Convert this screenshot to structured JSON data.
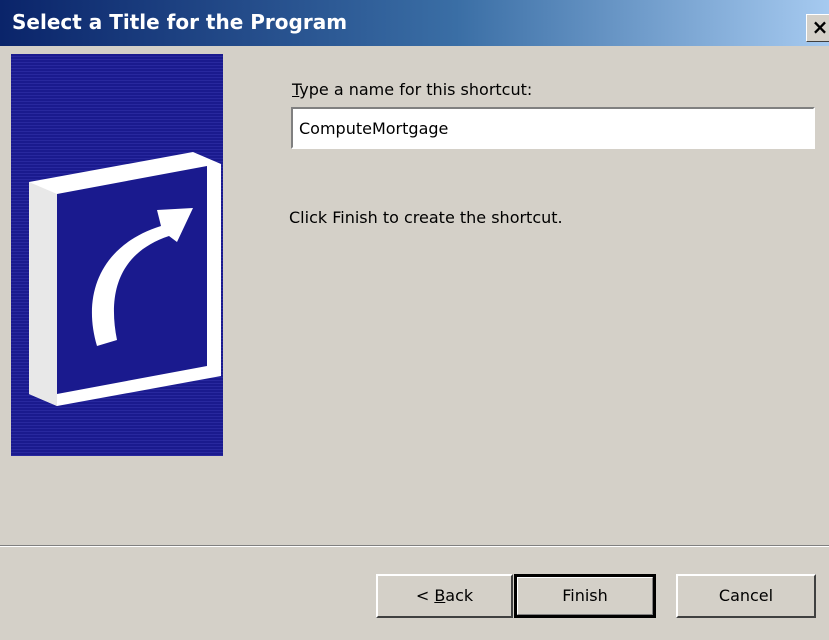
{
  "window": {
    "title": "Select a Title for the Program",
    "close_glyph": "×",
    "titlebar_colors": [
      "#0a246a",
      "#a6caf0"
    ]
  },
  "art": {
    "icon": "shortcut-arrow-icon",
    "background": "#1a1a8e"
  },
  "prompt": {
    "accelerator": "T",
    "rest": "ype a name for this shortcut:"
  },
  "name_field": {
    "value": "ComputeMortgage",
    "placeholder": ""
  },
  "info": "Click Finish to create the shortcut.",
  "buttons": {
    "back_prefix": "< ",
    "back_accel": "B",
    "back_rest": "ack",
    "finish": "Finish",
    "cancel": "Cancel"
  }
}
